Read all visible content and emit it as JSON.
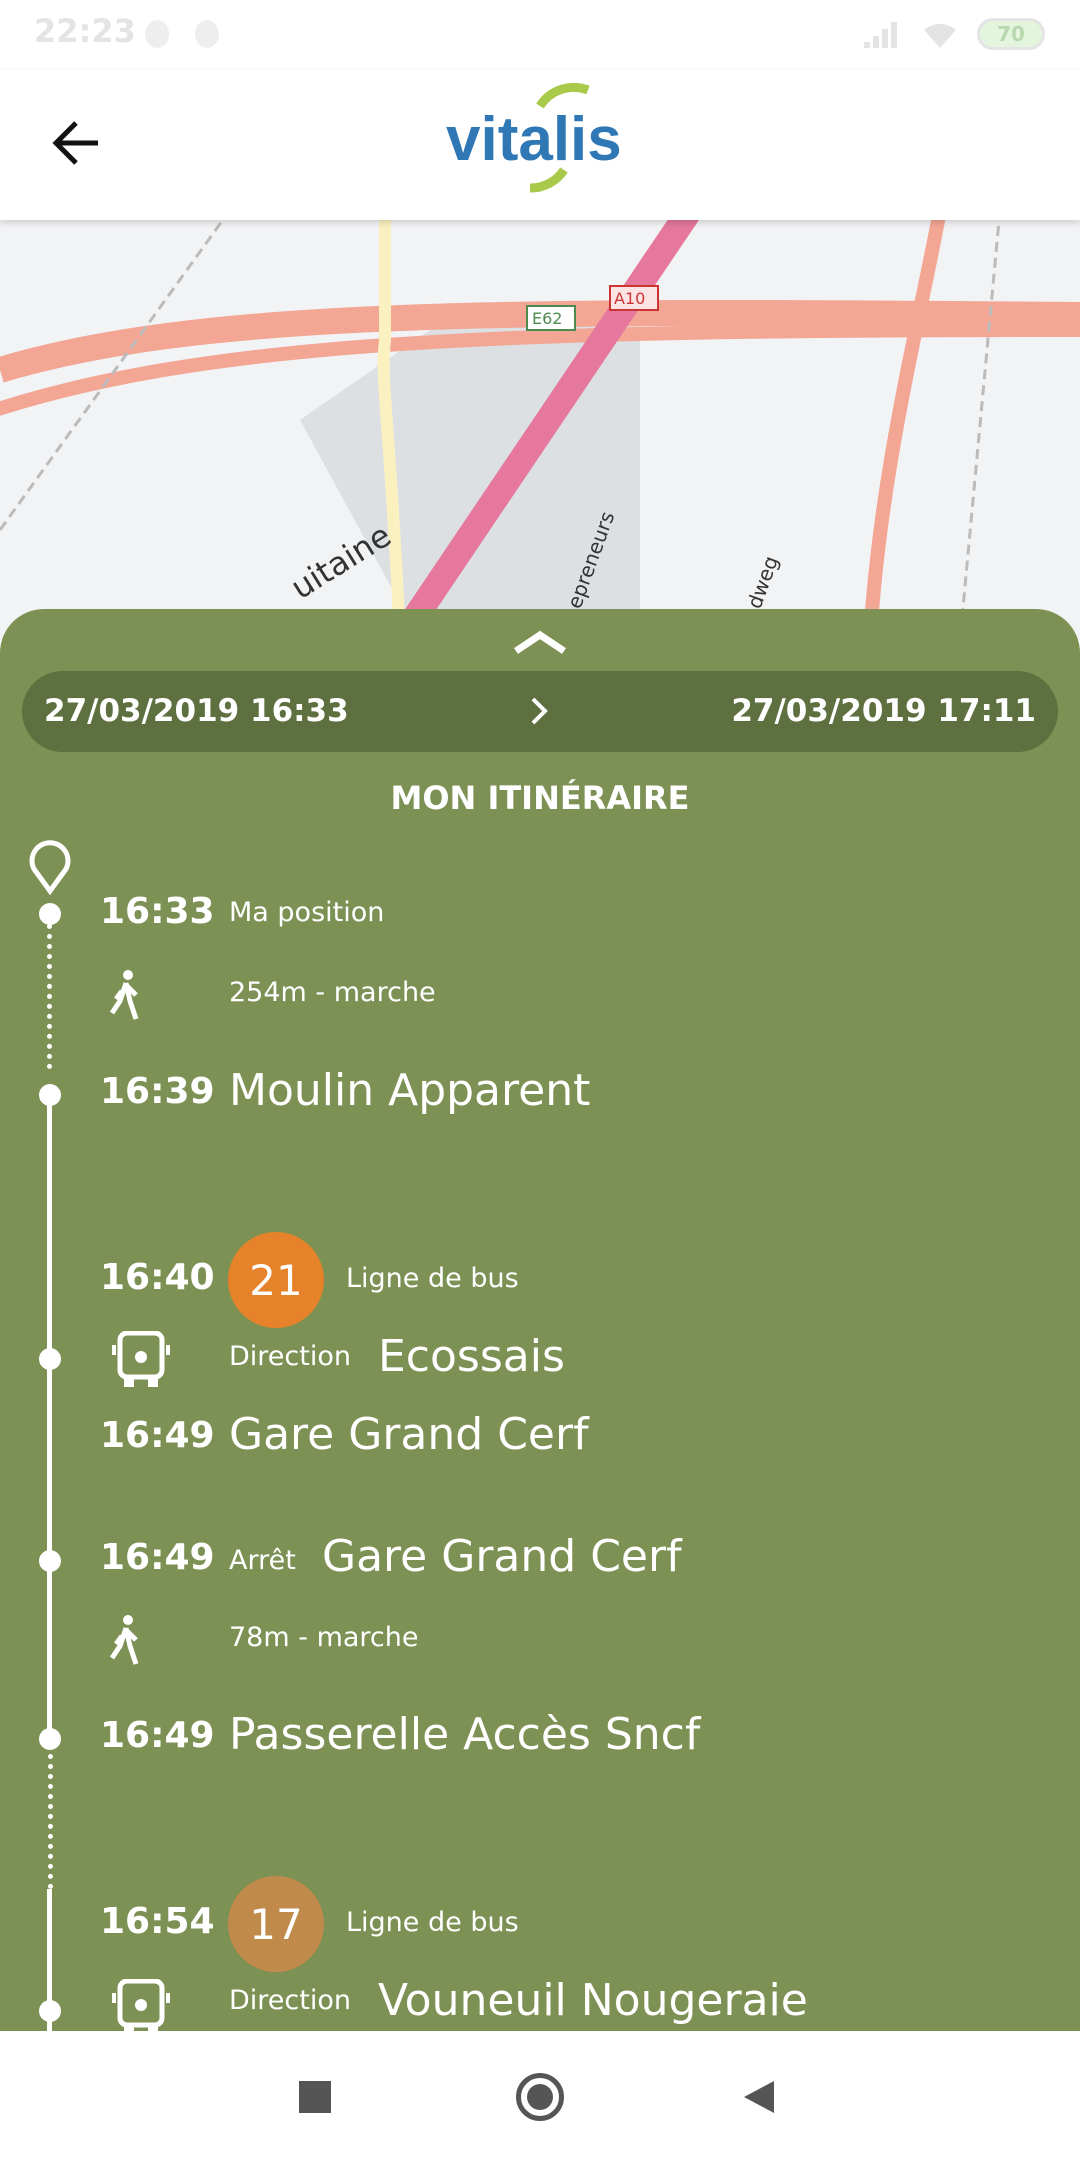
{
  "status_bar": {
    "time": "22:23",
    "battery": "70"
  },
  "header": {
    "logo_text": "vitalis",
    "back_icon": "arrow-left-icon"
  },
  "map": {
    "labels": [
      "E62",
      "A10",
      "uitaine",
      "epreneurs",
      "dweg"
    ]
  },
  "sheet": {
    "departure": "27/03/2019 16:33",
    "arrival": "27/03/2019 17:11",
    "title": "MON ITINÉRAIRE",
    "steps": [
      {
        "time": "16:33",
        "label": "Ma position"
      },
      {
        "walk": "254m - marche"
      },
      {
        "time": "16:39",
        "label": "Moulin Apparent"
      },
      {
        "time": "16:40",
        "line": "21",
        "line_color": "#e5822a",
        "line_label": "Ligne de bus",
        "direction_label": "Direction",
        "direction": "Ecossais"
      },
      {
        "time": "16:49",
        "label": "Gare Grand Cerf"
      },
      {
        "time": "16:49",
        "stop_label": "Arrêt",
        "label": "Gare Grand Cerf"
      },
      {
        "walk": "78m - marche"
      },
      {
        "time": "16:49",
        "label": "Passerelle Accès Sncf"
      },
      {
        "time": "16:54",
        "line": "17",
        "line_color": "#c08a4a",
        "line_label": "Ligne de bus",
        "direction_label": "Direction",
        "direction": "Vouneuil Nougeraie"
      }
    ]
  }
}
